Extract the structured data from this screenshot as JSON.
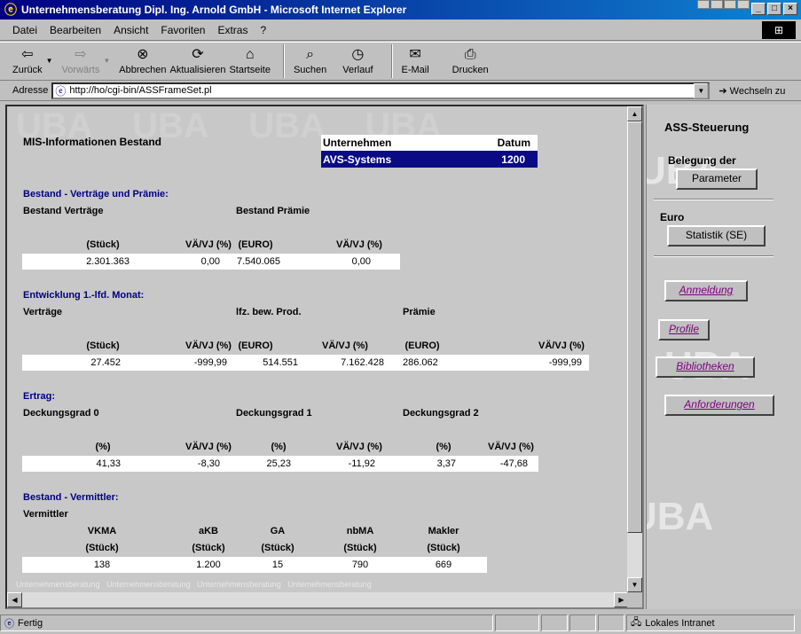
{
  "window": {
    "title": "Unternehmensberatung Dipl. Ing. Arnold GmbH - Microsoft Internet Explorer"
  },
  "menu": [
    "Datei",
    "Bearbeiten",
    "Ansicht",
    "Favoriten",
    "Extras",
    "?"
  ],
  "toolbar": {
    "back": "Zurück",
    "forward": "Vorwärts",
    "stop": "Abbrechen",
    "refresh": "Aktualisieren",
    "home": "Startseite",
    "search": "Suchen",
    "history": "Verlauf",
    "mail": "E-Mail",
    "print": "Drucken"
  },
  "address": {
    "label": "Adresse",
    "url": "http://ho/cgi-bin/ASSFrameSet.pl",
    "go": "Wechseln zu"
  },
  "page": {
    "title": "MIS-Informationen Bestand",
    "header": {
      "col1": "Unternehmen",
      "col2": "Datum",
      "company": "AVS-Systems",
      "date": "1200"
    },
    "bestand": {
      "section": "Bestand - Verträge und Prämie:",
      "lbl1": "Bestand Verträge",
      "lbl2": "Bestand Prämie",
      "headers": [
        "(Stück)",
        "VÄ/VJ (%)",
        "(EURO)",
        "VÄ/VJ (%)"
      ],
      "values": [
        "2.301.363",
        "0,00",
        "7.540.065",
        "0,00"
      ]
    },
    "entwicklung": {
      "section": "Entwicklung 1.-lfd. Monat:",
      "lbl1": "Verträge",
      "lbl2": "lfz. bew. Prod.",
      "lbl3": "Prämie",
      "headers": [
        "(Stück)",
        "VÄ/VJ (%)",
        "(EURO)",
        "VÄ/VJ (%)",
        "(EURO)",
        "VÄ/VJ (%)"
      ],
      "values": [
        "27.452",
        "-999,99",
        "514.551",
        "7.162.428",
        "286.062",
        "-999,99"
      ]
    },
    "ertrag": {
      "section": "Ertrag:",
      "lbl1": "Deckungsgrad 0",
      "lbl2": "Deckungsgrad 1",
      "lbl3": "Deckungsgrad 2",
      "headers": [
        "(%)",
        "VÄ/VJ (%)",
        "(%)",
        "VÄ/VJ (%)",
        "(%)",
        "VÄ/VJ (%)"
      ],
      "values": [
        "41,33",
        "-8,30",
        "25,23",
        "-11,92",
        "3,37",
        "-47,68"
      ]
    },
    "vermittler": {
      "section": "Bestand - Vermittler:",
      "lbl": "Vermittler",
      "headers": [
        "VKMA",
        "aKB",
        "GA",
        "nbMA",
        "Makler"
      ],
      "units": [
        "(Stück)",
        "(Stück)",
        "(Stück)",
        "(Stück)",
        "(Stück)"
      ],
      "values": [
        "138",
        "1.200",
        "15",
        "790",
        "669"
      ]
    },
    "watermark": "Unternehmensberatung"
  },
  "right_frame": {
    "title": "ASS-Steuerung",
    "belegung": "Belegung der",
    "parameter_btn": "Parameter",
    "euro": "Euro",
    "statistik_btn": "Statistik (SE)",
    "links": [
      "Anmeldung",
      "Profile",
      "Bibliotheken",
      "Anforderungen"
    ],
    "watermark": "UBA"
  },
  "status": {
    "text": "Fertig",
    "zone": "Lokales Intranet"
  },
  "colors": {
    "titlebar": "#000080",
    "section_blue": "#000080",
    "header_highlight": "#0a0a84",
    "link_purple": "#800080"
  }
}
